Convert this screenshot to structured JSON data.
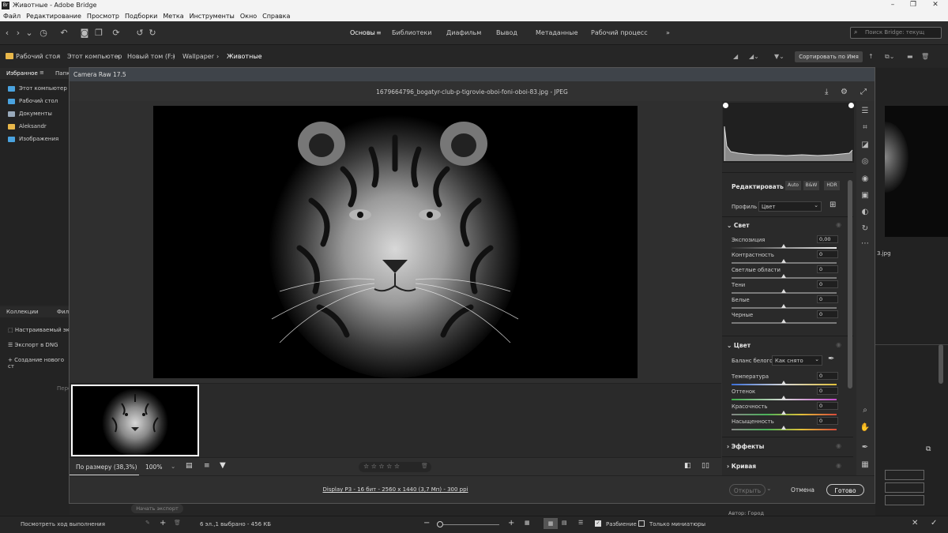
{
  "app": {
    "window_title": "Животные - Adobe Bridge",
    "logo": "Br",
    "menu": [
      "Файл",
      "Редактирование",
      "Просмотр",
      "Подборки",
      "Метка",
      "Инструменты",
      "Окно",
      "Справка"
    ]
  },
  "workspaces": {
    "items": [
      "Основы",
      "Библиотеки",
      "Диафильм",
      "Вывод",
      "Метаданные",
      "Рабочий процесс"
    ],
    "more": "»",
    "search_placeholder": "Поиск Bridge: текущ"
  },
  "path": {
    "segments": [
      "Рабочий стол",
      "Этот компьютер",
      "Новый том (F:)",
      "Wallpaper",
      "Животные"
    ],
    "sort_label": "Сортировать по Имя"
  },
  "left_panel": {
    "tabs": [
      "Избранное",
      "Папк"
    ],
    "favorites": [
      "Этот компьютер",
      "Рабочий стол",
      "Документы",
      "Aleksandr",
      "Изображения"
    ],
    "collections_tabs": [
      "Коллекции",
      "Фил"
    ],
    "collections": [
      "Настраиваемый эк",
      "Экспорт в DNG",
      "Создание нового ст"
    ],
    "hint": "Пере",
    "start_export": "Начать экспорт",
    "progress": "Посмотреть ход выполнения"
  },
  "status": {
    "text": "6 эл.,1 выбрано - 456 КБ",
    "split_label": "Разбиение",
    "thumbs_only_label": "Только миниатюры"
  },
  "right_panel": {
    "file_ext": "3.jpg",
    "author": "Автор: Город"
  },
  "camera_raw": {
    "title": "Camera Raw 17.5",
    "filename": "1679664796_bogatyr-club-p-tigrovie-oboi-foni-oboi-83.jpg  -  JPEG",
    "edit_title": "Редактировать",
    "edit_buttons": [
      "Auto",
      "B&W",
      "HDR"
    ],
    "profile_label": "Профиль",
    "profile_value": "Цвет",
    "light": {
      "title": "Свет",
      "sliders": [
        {
          "label": "Экспозиция",
          "value": "0,00"
        },
        {
          "label": "Контрастность",
          "value": "0"
        },
        {
          "label": "Светлые области",
          "value": "0"
        },
        {
          "label": "Тени",
          "value": "0"
        },
        {
          "label": "Белые",
          "value": "0"
        },
        {
          "label": "Черные",
          "value": "0"
        }
      ]
    },
    "color": {
      "title": "Цвет",
      "wb_label": "Баланс белого",
      "wb_value": "Как снято",
      "sliders": [
        {
          "label": "Температура",
          "value": "0"
        },
        {
          "label": "Оттенок",
          "value": "0"
        },
        {
          "label": "Красочность",
          "value": "0"
        },
        {
          "label": "Насыщенность",
          "value": "0"
        }
      ]
    },
    "effects_title": "Эффекты",
    "curve_title": "Кривая",
    "zoom_fit": "По размеру (38,3%)",
    "zoom_100": "100%",
    "stars": "☆ ☆ ☆ ☆ ☆",
    "footer_info": "Display P3 - 16 бит - 2560 x 1440 (3,7 Мп) - 300 ppi",
    "open_btn": "Открыть",
    "cancel_btn": "Отмена",
    "done_btn": "Готово"
  }
}
